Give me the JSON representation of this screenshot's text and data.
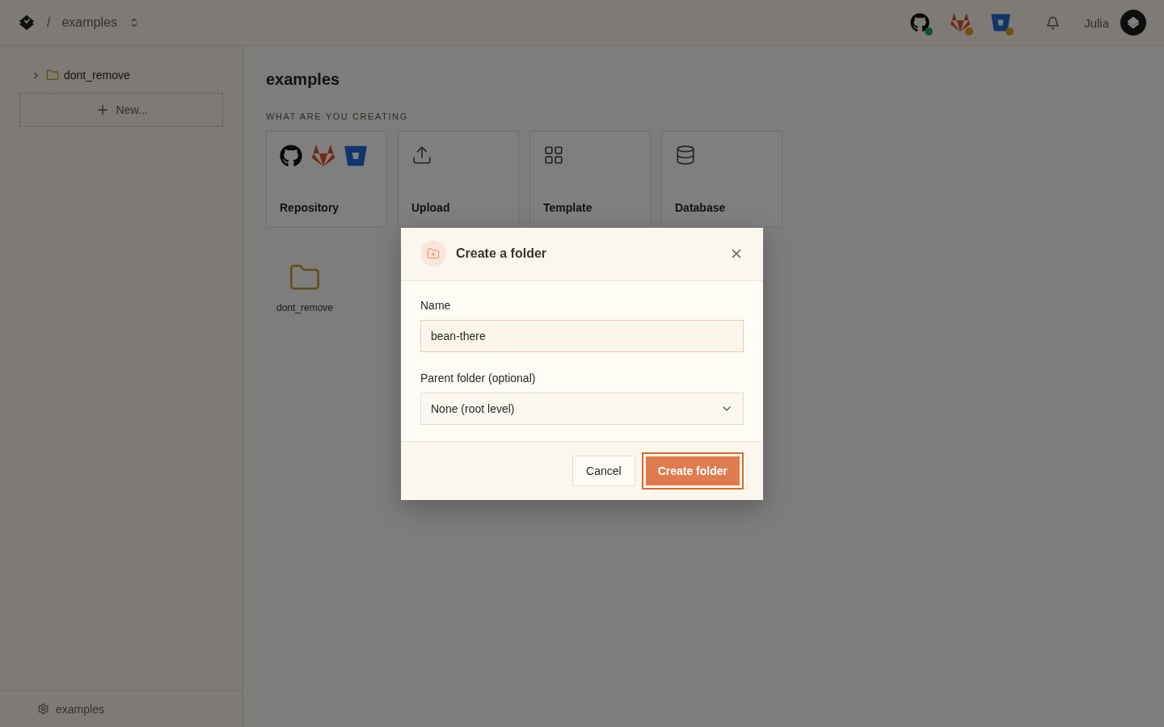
{
  "header": {
    "separator": "/",
    "workspace": "examples",
    "integrations": [
      {
        "kind": "github",
        "connected": true
      },
      {
        "kind": "gitlab",
        "connected": false
      },
      {
        "kind": "bitbucket",
        "connected": false
      }
    ],
    "user": "Julia"
  },
  "sidebar": {
    "items": [
      {
        "label": "dont_remove",
        "expanded": false
      }
    ],
    "new_button": "New...",
    "footer": "examples"
  },
  "main": {
    "title": "examples",
    "section_label": "WHAT ARE YOU CREATING",
    "options": [
      {
        "kind": "repository",
        "label": "Repository"
      },
      {
        "kind": "upload",
        "label": "Upload"
      },
      {
        "kind": "template",
        "label": "Template"
      },
      {
        "kind": "database",
        "label": "Database"
      }
    ],
    "folders": [
      {
        "name": "dont_remove"
      }
    ]
  },
  "dialog": {
    "title": "Create a folder",
    "name_label": "Name",
    "name_value": "bean-there",
    "parent_label": "Parent folder (optional)",
    "parent_value": "None (root level)",
    "cancel": "Cancel",
    "submit": {
      "label": "Create folder",
      "focused": true
    }
  }
}
